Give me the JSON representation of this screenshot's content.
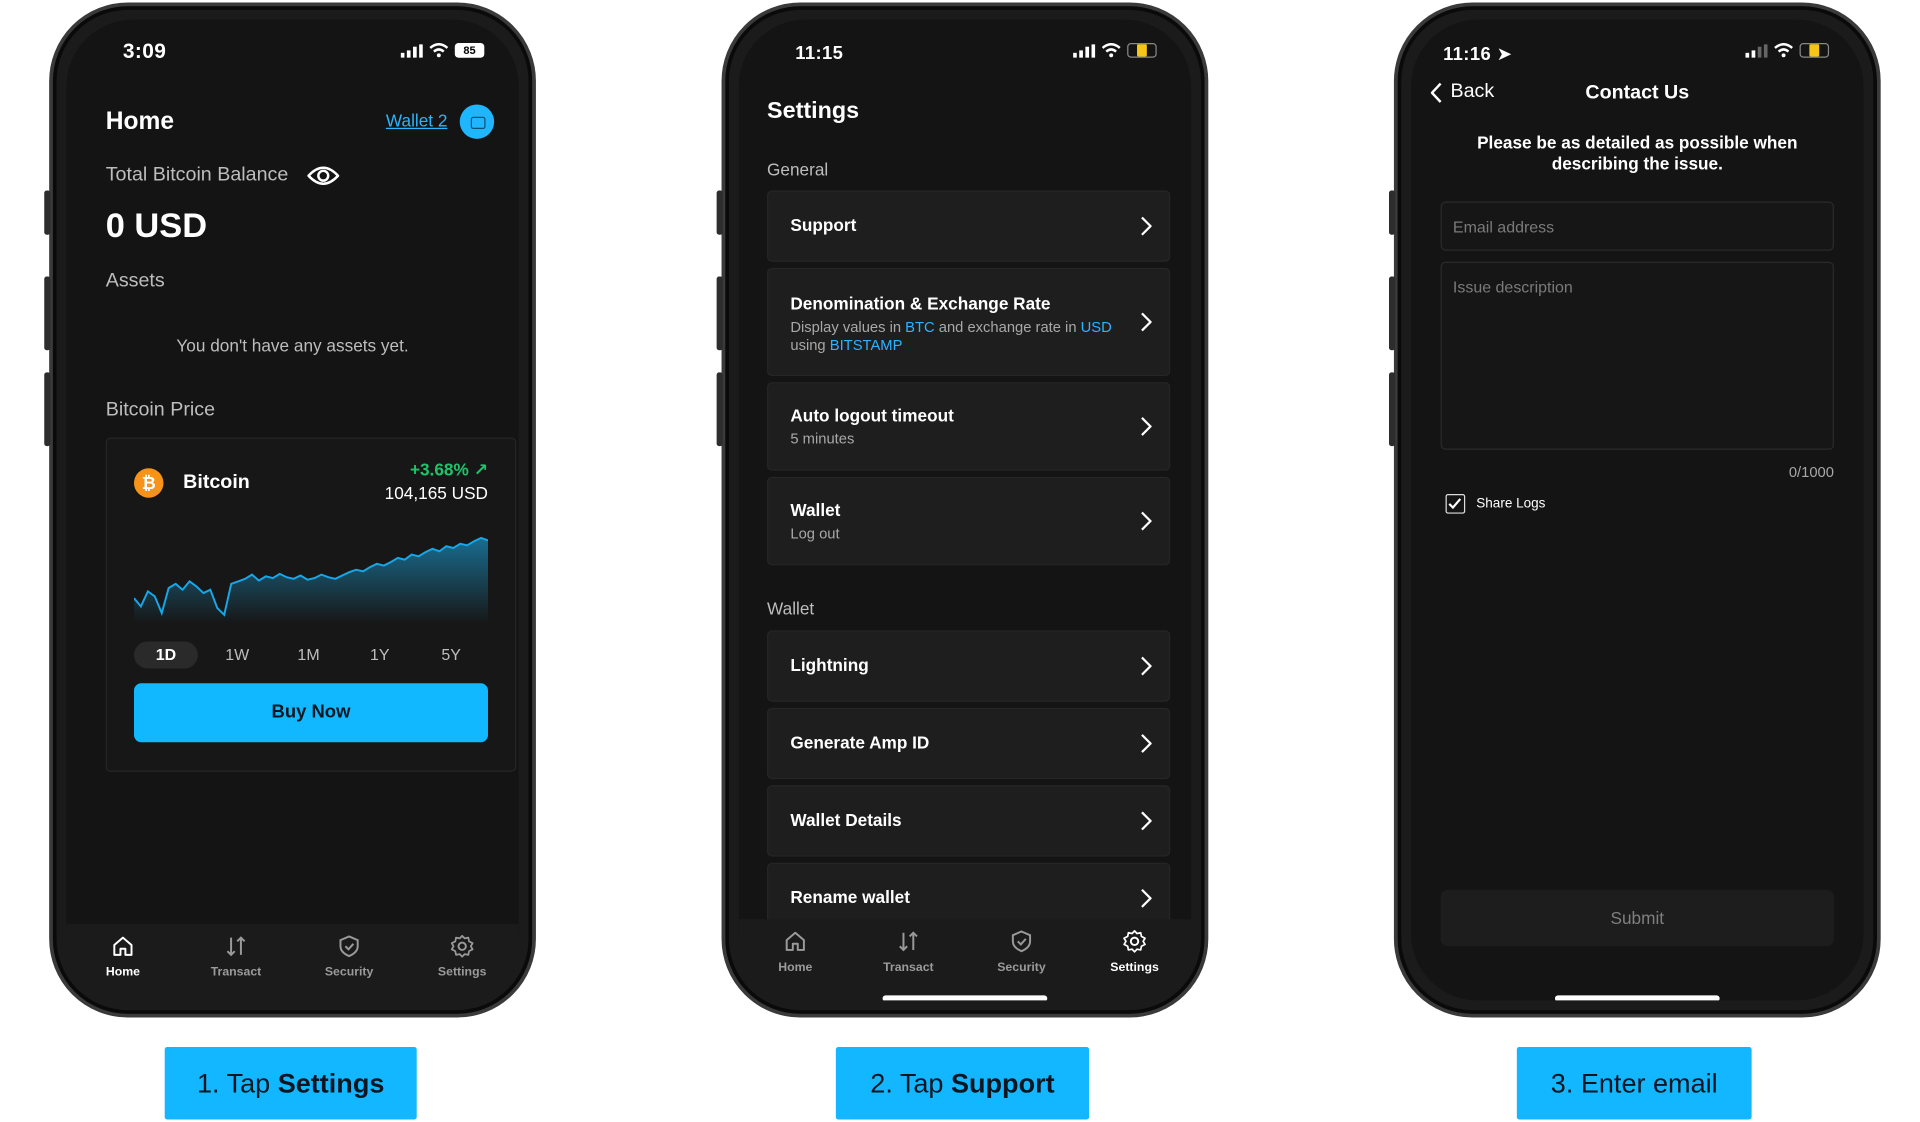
{
  "phone1": {
    "time": "3:09",
    "battery": "85",
    "title": "Home",
    "wallet_link": "Wallet 2",
    "balance_label": "Total Bitcoin Balance",
    "balance_value": "0 USD",
    "assets_label": "Assets",
    "assets_empty": "You don't have any assets yet.",
    "price_label": "Bitcoin Price",
    "coin_name": "Bitcoin",
    "change": "+3.68%",
    "price": "104,165 USD",
    "ranges": [
      "1D",
      "1W",
      "1M",
      "1Y",
      "5Y"
    ],
    "active_range": "1D",
    "buy_button": "Buy Now",
    "tabs": [
      "Home",
      "Transact",
      "Security",
      "Settings"
    ],
    "active_tab": "Home",
    "accent_color": "#12b7ff",
    "positive_color": "#1fc36b",
    "price_series": [
      0.24,
      0.14,
      0.32,
      0.26,
      0.06,
      0.36,
      0.41,
      0.34,
      0.44,
      0.38,
      0.3,
      0.34,
      0.12,
      0.04,
      0.41,
      0.44,
      0.47,
      0.52,
      0.45,
      0.5,
      0.48,
      0.53,
      0.49,
      0.47,
      0.51,
      0.46,
      0.48,
      0.52,
      0.49,
      0.47,
      0.51,
      0.55,
      0.58,
      0.56,
      0.61,
      0.65,
      0.63,
      0.67,
      0.72,
      0.7,
      0.76,
      0.74,
      0.79,
      0.83,
      0.8,
      0.86,
      0.84,
      0.89,
      0.87,
      0.92,
      0.96,
      0.93
    ]
  },
  "phone2": {
    "time": "11:15",
    "title": "Settings",
    "group_general": "General",
    "group_wallet": "Wallet",
    "rows": {
      "support": "Support",
      "denom_title": "Denomination & Exchange Rate",
      "denom_sub_1": "Display values in ",
      "denom_btc": "BTC",
      "denom_sub_2": " and exchange rate in ",
      "denom_usd": "USD",
      "denom_sub_3": " using ",
      "denom_src": "BITSTAMP",
      "autologout_title": "Auto logout timeout",
      "autologout_sub": "5 minutes",
      "wallet_title": "Wallet",
      "wallet_sub": "Log out",
      "lightning": "Lightning",
      "amp": "Generate Amp ID",
      "details": "Wallet Details",
      "rename": "Rename wallet"
    },
    "tabs": [
      "Home",
      "Transact",
      "Security",
      "Settings"
    ],
    "active_tab": "Settings"
  },
  "phone3": {
    "time": "11:16",
    "back": "Back",
    "title": "Contact Us",
    "instructions": "Please be as detailed as possible when describing the issue.",
    "email_placeholder": "Email address",
    "issue_placeholder": "Issue description",
    "counter": "0/1000",
    "share_logs": "Share Logs",
    "share_logs_checked": true,
    "submit": "Submit"
  },
  "captions": {
    "step1_pre": "1. Tap ",
    "step1_bold": "Settings",
    "step2_pre": "2. Tap ",
    "step2_bold": "Support",
    "step3": "3. Enter email"
  }
}
